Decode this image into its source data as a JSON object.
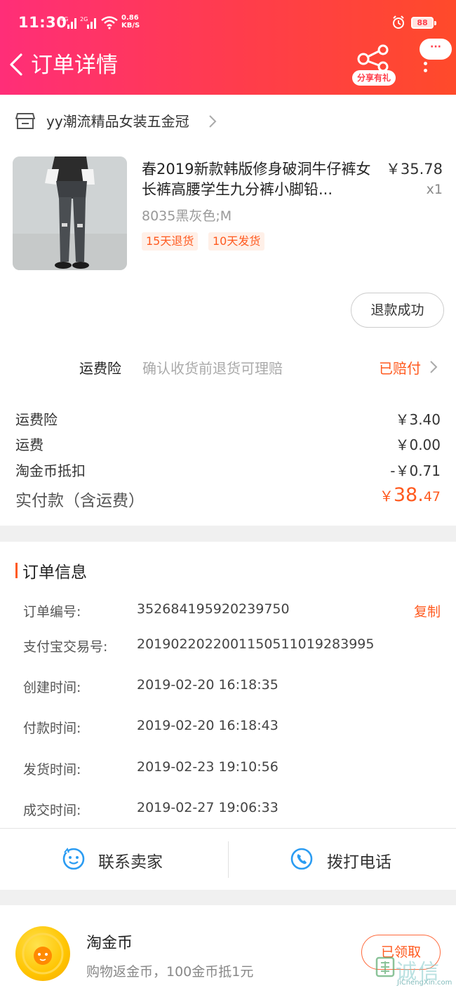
{
  "status_bar": {
    "time": "11:30",
    "net1": "4G",
    "net2": "2G",
    "speed_value": "0.86",
    "speed_unit": "KB/S",
    "battery": "88"
  },
  "nav": {
    "title": "订单详情",
    "share_label": "分享有礼",
    "more_label": "···"
  },
  "shop": {
    "name": "yy潮流精品女装五金冠"
  },
  "product": {
    "title": "春2019新款韩版修身破洞牛仔裤女长裤高腰学生九分裤小脚铅...",
    "price": "￥35.78",
    "quantity": "x1",
    "sku": "8035黑灰色;M",
    "tags": [
      "15天退货",
      "10天发货"
    ],
    "refund_status": "退款成功"
  },
  "insurance": {
    "label": "运费险",
    "description": "确认收货前退货可理赔",
    "status": "已赔付"
  },
  "fees": [
    {
      "label": "运费险",
      "value": "￥3.40"
    },
    {
      "label": "运费",
      "value": "￥0.00"
    },
    {
      "label": "淘金币抵扣",
      "value": "-￥0.71"
    }
  ],
  "total": {
    "label": "实付款（含运费）",
    "currency": "￥",
    "integer": "38.",
    "decimal": "47"
  },
  "order_info": {
    "title": "订单信息",
    "copy_label": "复制",
    "rows": [
      {
        "label": "订单编号:",
        "value": "352684195920239750"
      },
      {
        "label": "支付宝交易号:",
        "value": "2019022022001150511019283995"
      },
      {
        "label": "创建时间:",
        "value": "2019-02-20 16:18:35"
      },
      {
        "label": "付款时间:",
        "value": "2019-02-20 16:18:43"
      },
      {
        "label": "发货时间:",
        "value": "2019-02-23 19:10:56"
      },
      {
        "label": "成交时间:",
        "value": "2019-02-27 19:06:33"
      }
    ]
  },
  "contact": {
    "seller_label": "联系卖家",
    "phone_label": "拨打电话"
  },
  "taojinbi": {
    "title": "淘金币",
    "description": "购物返金币，100金币抵1元",
    "button_label": "已领取"
  },
  "watermark": {
    "text": "诚信",
    "sub": "JiChengXin.com"
  },
  "colors": {
    "accent": "#ff5a1f",
    "header_start": "#ff2e78",
    "header_end": "#ff4a2a"
  }
}
